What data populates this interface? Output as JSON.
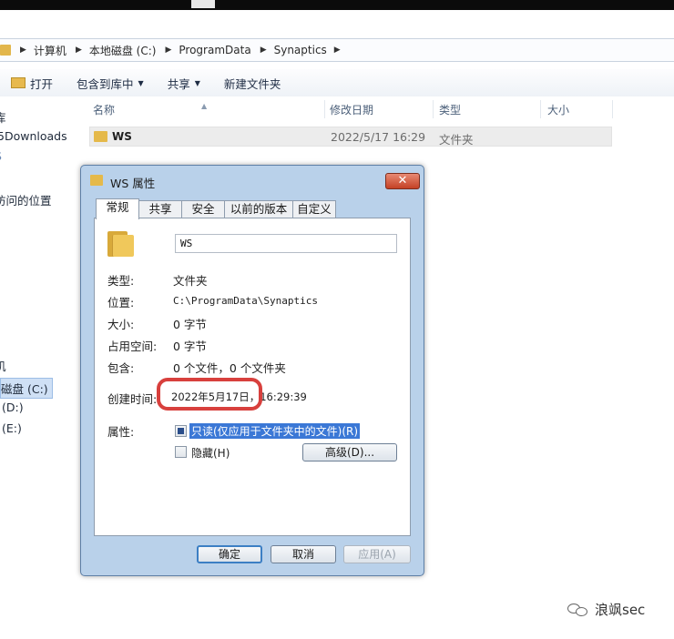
{
  "address_bar": {
    "segments": [
      "计算机",
      "本地磁盘 (C:)",
      "ProgramData",
      "Synaptics"
    ]
  },
  "toolbar": {
    "open": "打开",
    "include_library": "包含到库中",
    "share": "共享",
    "new_folder": "新建文件夹"
  },
  "list": {
    "columns": [
      "名称",
      "修改日期",
      "类型",
      "大小"
    ],
    "rows": [
      {
        "name": "WS",
        "modified": "2022/5/17 16:29",
        "type": "文件夹",
        "size": ""
      }
    ]
  },
  "nav_pane": {
    "items": [
      "库",
      "5Downloads",
      "S",
      "访问的位置",
      "机",
      "磁盘 (C:)",
      "(D:)",
      "(E:)"
    ]
  },
  "dialog": {
    "title": "WS 属性",
    "close_glyph": "✕",
    "tabs": [
      "常规",
      "共享",
      "安全",
      "以前的版本",
      "自定义"
    ],
    "active_tab": "常规",
    "folder_name": "WS",
    "props": {
      "type_label": "类型:",
      "type_value": "文件夹",
      "location_label": "位置:",
      "location_value": "C:\\ProgramData\\Synaptics",
      "size_label": "大小:",
      "size_value": "0 字节",
      "disk_size_label": "占用空间:",
      "disk_size_value": "0 字节",
      "contains_label": "包含:",
      "contains_value": "0 个文件，0 个文件夹",
      "created_label": "创建时间:",
      "created_value": "2022年5月17日，16:29:39",
      "attributes_label": "属性:"
    },
    "attributes": {
      "readonly": "只读(仅应用于文件夹中的文件)(R)",
      "readonly_checked": true,
      "hidden": "隐藏(H)",
      "hidden_checked": false,
      "advanced": "高级(D)..."
    },
    "buttons": {
      "ok": "确定",
      "cancel": "取消",
      "apply": "应用(A)"
    }
  },
  "watermark": {
    "text": "浪飒sec"
  },
  "colors": {
    "highlight": "#d8403d",
    "dialog_frame": "#b9d1ea",
    "selection": "#3b78d6"
  }
}
